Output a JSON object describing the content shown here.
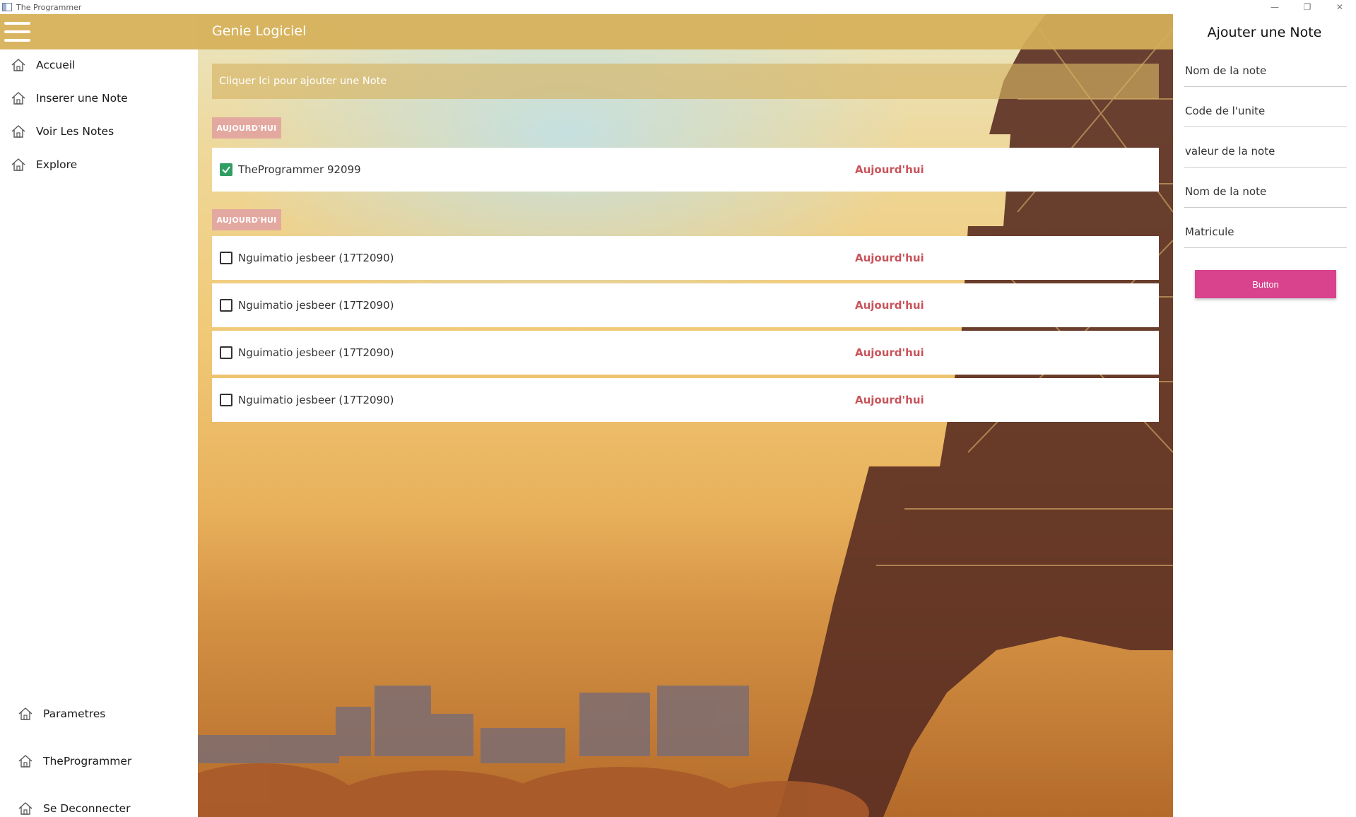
{
  "window": {
    "title": "The Programmer",
    "minimize": "—",
    "restore": "❐",
    "close": "✕"
  },
  "sidebar": {
    "items": [
      {
        "label": "Accueil",
        "icon": "home-icon"
      },
      {
        "label": "Inserer une Note",
        "icon": "home-icon"
      },
      {
        "label": "Voir Les Notes",
        "icon": "home-icon"
      },
      {
        "label": "Explore",
        "icon": "home-icon"
      }
    ],
    "bottom_items": [
      {
        "label": "Parametres",
        "icon": "home-icon"
      },
      {
        "label": "TheProgrammer",
        "icon": "home-icon"
      },
      {
        "label": "Se Deconnecter",
        "icon": "home-icon"
      }
    ]
  },
  "header": {
    "title": "Genie Logiciel"
  },
  "main": {
    "add_placeholder": "Cliquer Ici pour ajouter une Note",
    "groups": [
      {
        "chip": "AUJOURD'HUI",
        "notes": [
          {
            "text": "TheProgrammer 92099",
            "date": "Aujourd'hui",
            "checked": true
          }
        ]
      },
      {
        "chip": "AUJOURD'HUI",
        "notes": [
          {
            "text": "Nguimatio jesbeer  (17T2090)",
            "date": "Aujourd'hui",
            "checked": false
          },
          {
            "text": "Nguimatio jesbeer  (17T2090)",
            "date": "Aujourd'hui",
            "checked": false
          },
          {
            "text": "Nguimatio jesbeer  (17T2090)",
            "date": "Aujourd'hui",
            "checked": false
          },
          {
            "text": "Nguimatio jesbeer  (17T2090)",
            "date": "Aujourd'hui",
            "checked": false
          }
        ]
      }
    ]
  },
  "panel": {
    "title": "Ajouter une Note",
    "fields": [
      {
        "placeholder": "Nom de la note"
      },
      {
        "placeholder": "Code de l'unite"
      },
      {
        "placeholder": "valeur de la note"
      },
      {
        "placeholder": "Nom de la note"
      },
      {
        "placeholder": "Matricule"
      }
    ],
    "button_label": "Button"
  },
  "colors": {
    "accent_header": "#d9b561",
    "chip": "#e3a8a0",
    "date_text": "#c9545b",
    "button": "#d9428c",
    "checkbox_checked": "#2e9e62"
  }
}
